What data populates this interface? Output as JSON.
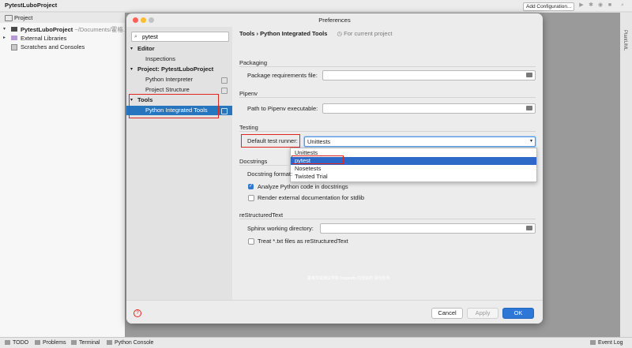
{
  "ide": {
    "window_title": "PytestLuboProject",
    "run_config_label": "Add Configuration...",
    "project_panel_label": "Project",
    "tree": [
      {
        "label": "PytestLuboProject",
        "path": "~/Documents/霍格..."
      },
      {
        "label": "External Libraries"
      },
      {
        "label": "Scratches and Consoles"
      }
    ],
    "right_strip_label": "PlantUML",
    "bottom_tabs": [
      "TODO",
      "Problems",
      "Terminal",
      "Python Console"
    ],
    "event_log": "Event Log"
  },
  "dialog": {
    "title": "Preferences",
    "search_value": "pytest",
    "nav": {
      "editor": "Editor",
      "inspections": "Inspections",
      "project": "Project: PytestLuboProject",
      "python_interpreter": "Python Interpreter",
      "project_structure": "Project Structure",
      "tools": "Tools",
      "python_integrated_tools": "Python Integrated Tools"
    },
    "breadcrumb": {
      "root": "Tools",
      "sep": "›",
      "leaf": "Python Integrated Tools",
      "scope": "For current project"
    },
    "sections": {
      "packaging": {
        "title": "Packaging",
        "requirements_label": "Package requirements file:",
        "requirements_value": ""
      },
      "pipenv": {
        "title": "Pipenv",
        "path_label": "Path to Pipenv executable:",
        "path_value": ""
      },
      "testing": {
        "title": "Testing",
        "runner_label": "Default test runner:",
        "runner_value": "Unittests",
        "runner_options": [
          "Unittests",
          "pytest",
          "Nosetests",
          "Twisted Trial"
        ],
        "highlighted_option": "pytest"
      },
      "docstrings": {
        "title": "Docstrings",
        "format_label": "Docstring format:",
        "analyze_label": "Analyze Python code in docstrings",
        "analyze_checked": true,
        "render_label": "Render external documentation for stdlib",
        "render_checked": false
      },
      "restructuredtext": {
        "title": "reStructuredText",
        "sphinx_label": "Sphinx working directory:",
        "sphinx_value": "",
        "treat_label": "Treat *.txt files as reStructuredText",
        "treat_checked": false
      }
    },
    "watermark": "霍格沃兹测试学院 hogwarts 内部资料 请勿外传",
    "buttons": {
      "help": "?",
      "cancel": "Cancel",
      "apply": "Apply",
      "ok": "OK"
    },
    "colors": {
      "accent": "#2675bf",
      "highlight_box": "#e0261e",
      "ok_button": "#2d78d6"
    }
  }
}
